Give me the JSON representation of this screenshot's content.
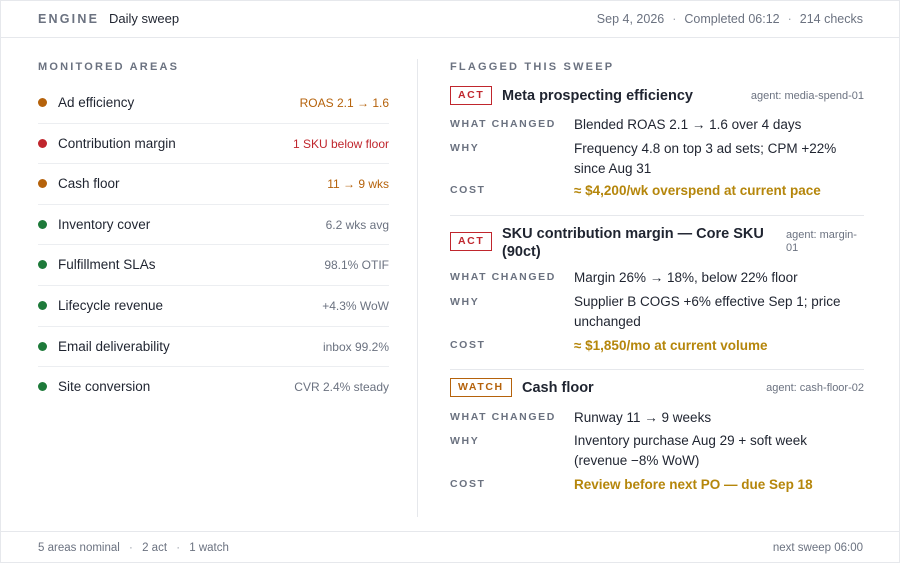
{
  "header": {
    "brand": "ENGINE",
    "title": "Daily sweep",
    "date": "Sep 4, 2026",
    "completed": "Completed 06:12",
    "checks": "214 checks",
    "separator": "·"
  },
  "monitored": {
    "label": "MONITORED AREAS",
    "items": [
      {
        "name": "Ad efficiency",
        "status": "ROAS 2.1 → 1.6",
        "level": "watch"
      },
      {
        "name": "Contribution margin",
        "status": "1 SKU below floor",
        "level": "act"
      },
      {
        "name": "Cash floor",
        "status": "11 → 9 wks",
        "level": "watch"
      },
      {
        "name": "Inventory cover",
        "status": "6.2 wks avg",
        "level": "ok"
      },
      {
        "name": "Fulfillment SLAs",
        "status": "98.1% OTIF",
        "level": "ok"
      },
      {
        "name": "Lifecycle revenue",
        "status": "+4.3% WoW",
        "level": "ok"
      },
      {
        "name": "Email deliverability",
        "status": "inbox 99.2%",
        "level": "ok"
      },
      {
        "name": "Site conversion",
        "status": "CVR 2.4% steady",
        "level": "ok"
      }
    ]
  },
  "colors": {
    "act": "#c0262d",
    "watch": "#b5620b",
    "ok": "#1e7a3a",
    "ok_text": "#6b7280",
    "cost": "#b5860b"
  },
  "flagged": {
    "label": "FLAGGED THIS SWEEP",
    "labels": {
      "what": "WHAT CHANGED",
      "why": "WHY",
      "cost": "COST"
    },
    "items": [
      {
        "badge": "ACT",
        "title": "Meta prospecting efficiency",
        "agent": "agent: media-spend-01",
        "what": "Blended ROAS 2.1 → 1.6 over 4 days",
        "why": "Frequency 4.8 on top 3 ad sets; CPM +22% since Aug 31",
        "cost": "≈ $4,200/wk overspend at current pace"
      },
      {
        "badge": "ACT",
        "title": "SKU contribution margin — Core SKU (90ct)",
        "agent": "agent: margin-01",
        "what": "Margin 26% → 18%, below 22% floor",
        "why": "Supplier B COGS +6% effective Sep 1; price unchanged",
        "cost": "≈ $1,850/mo at current volume"
      },
      {
        "badge": "WATCH",
        "title": "Cash floor",
        "agent": "agent: cash-floor-02",
        "what": "Runway 11 → 9 weeks",
        "why": "Inventory purchase Aug 29 + soft week (revenue −8% WoW)",
        "cost": "Review before next PO — due Sep 18"
      }
    ]
  },
  "footer": {
    "nominal": "5 areas nominal",
    "act": "2 act",
    "watch": "1 watch",
    "next": "next sweep 06:00"
  }
}
